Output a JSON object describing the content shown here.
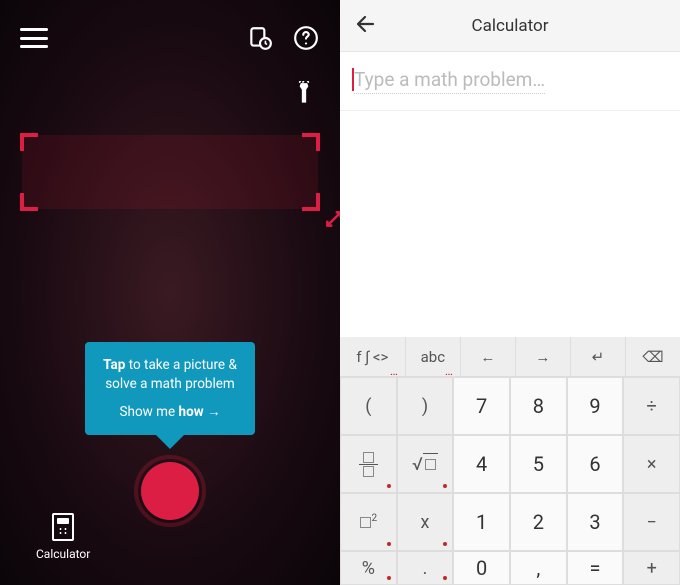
{
  "left": {
    "tooltip": {
      "tap": "Tap",
      "line1_rest": " to take a picture & solve a math problem",
      "show_prefix": "Show me ",
      "show_bold": "how",
      "show_arrow": " →"
    },
    "calculator_label": "Calculator"
  },
  "right": {
    "title": "Calculator",
    "placeholder": "Type a math problem…",
    "mode_row": [
      "f ∫ <>",
      "abc",
      "←",
      "→",
      "↵",
      "⌫"
    ],
    "rows": [
      {
        "fn": [
          "(",
          ")"
        ],
        "num": [
          "7",
          "8",
          "9"
        ],
        "op": "÷"
      },
      {
        "fn": [
          "frac",
          "sqrt"
        ],
        "num": [
          "4",
          "5",
          "6"
        ],
        "op": "×"
      },
      {
        "fn": [
          "sqr",
          "x"
        ],
        "num": [
          "1",
          "2",
          "3"
        ],
        "op": "−"
      },
      {
        "fn": [
          "%",
          "."
        ],
        "num": [
          "0",
          ",",
          "="
        ],
        "op": "+"
      }
    ]
  }
}
